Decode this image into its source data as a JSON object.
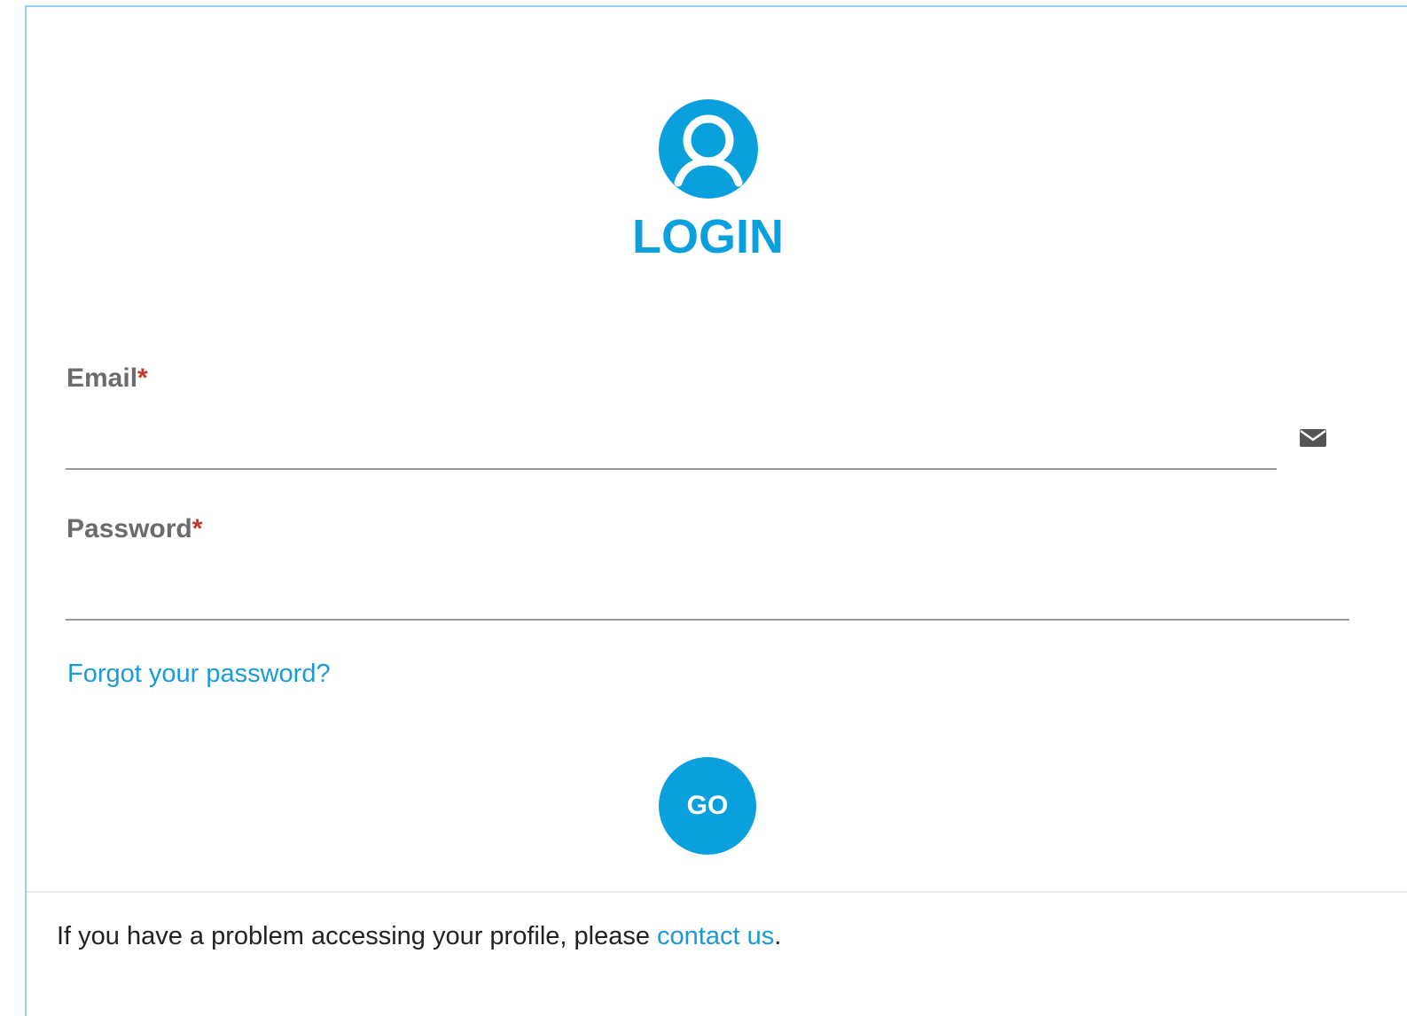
{
  "header": {
    "title": "LOGIN",
    "avatar_icon": "user-circle-icon"
  },
  "form": {
    "email": {
      "label": "Email",
      "required_mark": "*",
      "value": "",
      "icon": "envelope-icon"
    },
    "password": {
      "label": "Password",
      "required_mark": "*",
      "value": ""
    },
    "forgot_link": "Forgot your password?",
    "submit_label": "GO"
  },
  "footer": {
    "text": "If you have a problem accessing your profile, please ",
    "link": "contact us",
    "suffix": "."
  },
  "colors": {
    "accent": "#0aa0dd",
    "link": "#1a9bd7",
    "required": "#c0392b",
    "border": "#8fd3f1"
  }
}
